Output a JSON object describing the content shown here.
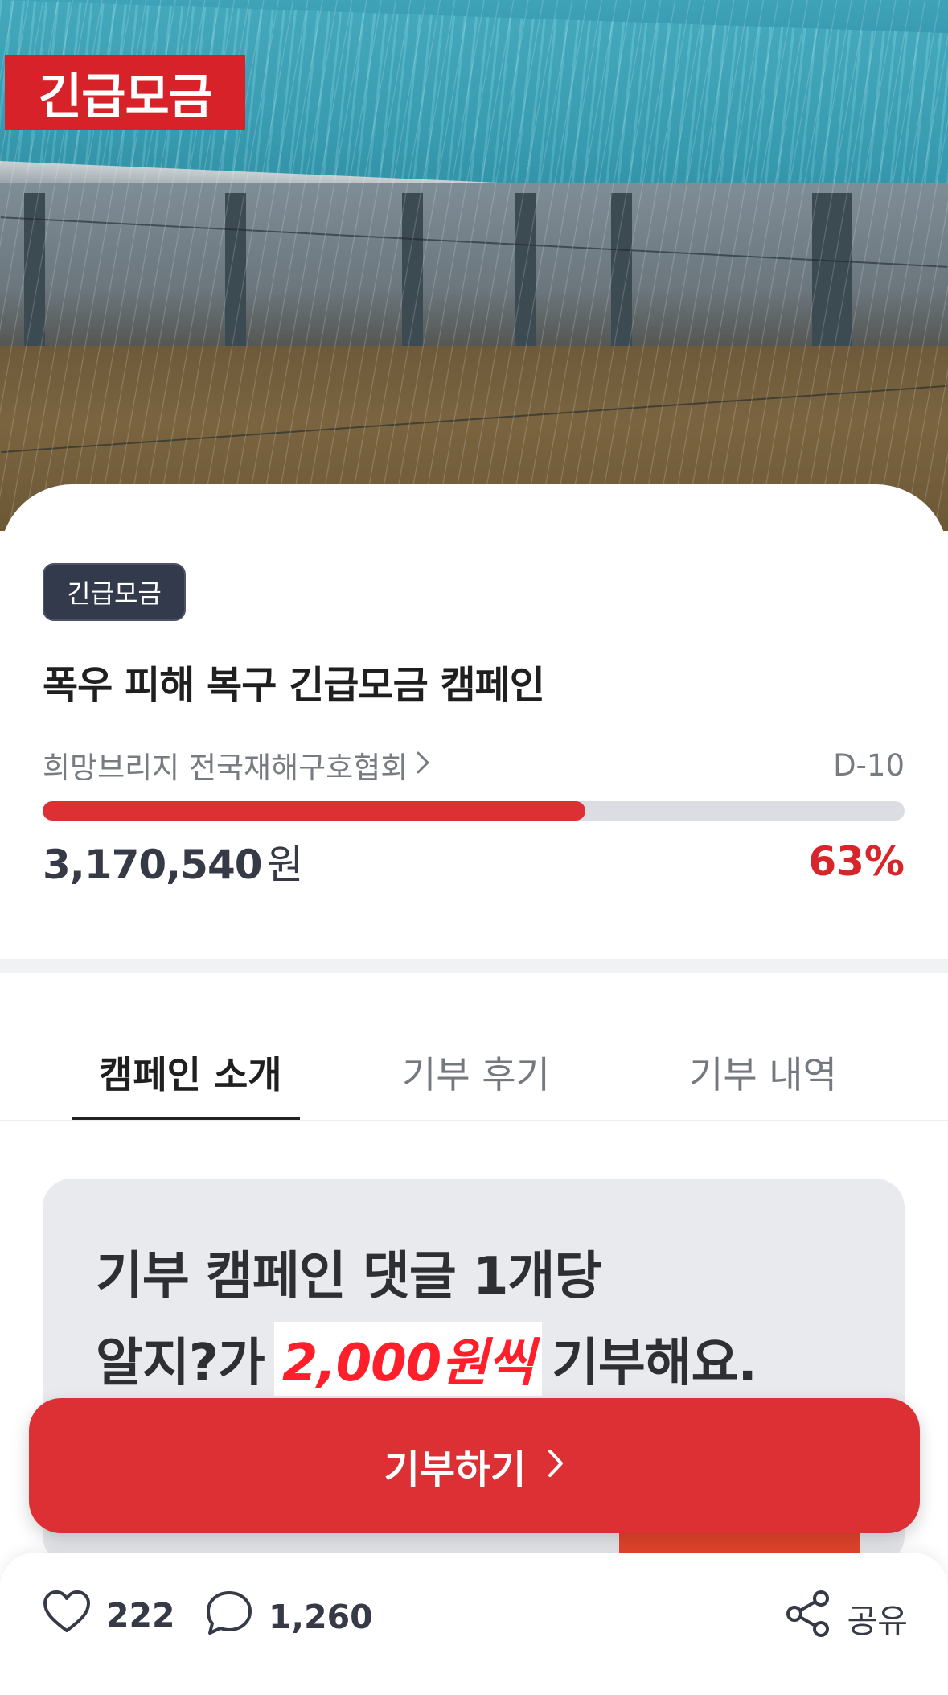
{
  "hero": {
    "badge": "긴급모금"
  },
  "campaign": {
    "chip": "긴급모금",
    "title": "폭우 피해 복구 긴급모금 캠페인",
    "organization": "희망브리지 전국재해구호협회",
    "dday": "D-10",
    "amount": "3,170,540",
    "amount_unit": "원",
    "percent_label": "63%",
    "progress_fraction": 0.63
  },
  "tabs": [
    {
      "label": "캠페인 소개",
      "active": true
    },
    {
      "label": "기부 후기",
      "active": false
    },
    {
      "label": "기부 내역",
      "active": false
    }
  ],
  "banner": {
    "line1": "기부 캠페인 댓글 1개당",
    "line2_prefix": "알지?가",
    "line2_highlight": "2,000원씩",
    "line2_suffix": "기부해요."
  },
  "donate_button": {
    "label": "기부하기"
  },
  "bottom_bar": {
    "likes": "222",
    "comments": "1,260",
    "share_label": "공유"
  },
  "colors": {
    "accent_red": "#dd3034",
    "chip_dark": "#333a4c",
    "progress_track": "#dcdde2"
  },
  "icons": [
    "heart-icon",
    "comment-icon",
    "share-icon",
    "chevron-right-icon"
  ]
}
